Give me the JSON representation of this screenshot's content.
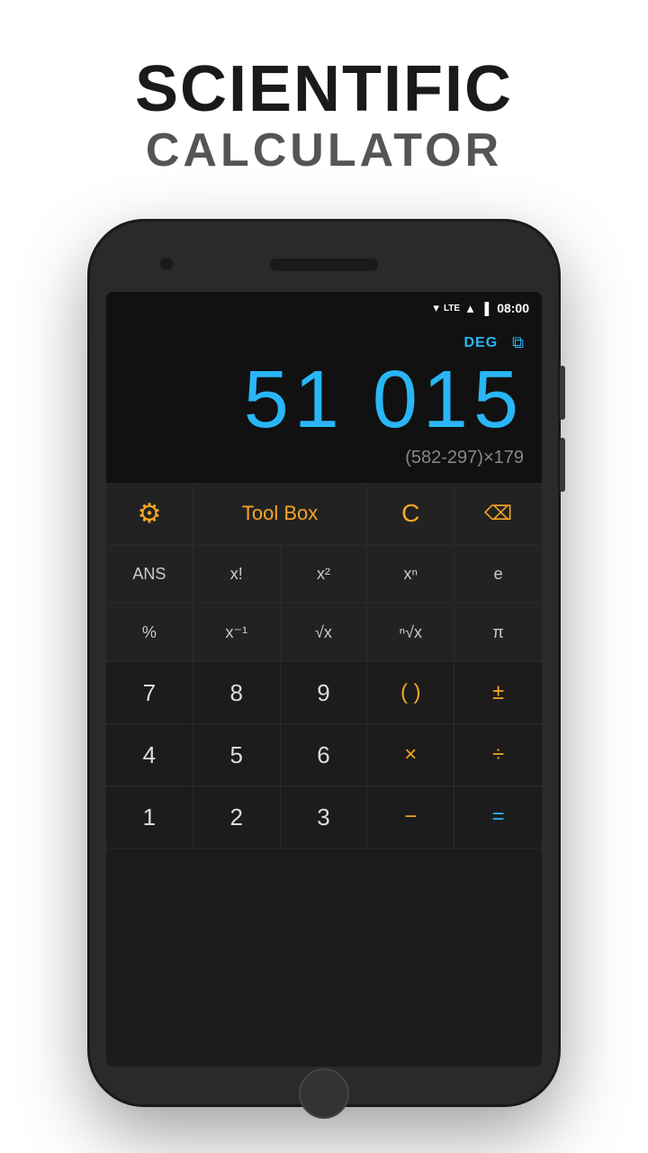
{
  "header": {
    "line1": "SCIENTIFIC",
    "line2": "CALCULATOR"
  },
  "status_bar": {
    "time": "08:00",
    "lte": "LTE"
  },
  "calculator": {
    "deg_label": "DEG",
    "result": "51 015",
    "expression": "(582-297)×179",
    "toolbar": {
      "toolbox_label": "Tool Box",
      "clear_label": "C"
    },
    "sci_row1": [
      {
        "label": "ANS",
        "id": "ans-btn"
      },
      {
        "label": "x!",
        "id": "factorial-btn"
      },
      {
        "label": "x²",
        "id": "square-btn"
      },
      {
        "label": "xⁿ",
        "id": "power-btn"
      },
      {
        "label": "e",
        "id": "euler-btn"
      }
    ],
    "sci_row2": [
      {
        "label": "%",
        "id": "percent-btn"
      },
      {
        "label": "x⁻¹",
        "id": "inverse-btn"
      },
      {
        "label": "√x",
        "id": "sqrt-btn"
      },
      {
        "label": "ⁿ√x",
        "id": "nroot-btn"
      },
      {
        "label": "π",
        "id": "pi-btn"
      }
    ],
    "num_row1": [
      {
        "label": "7",
        "type": "num"
      },
      {
        "label": "8",
        "type": "num"
      },
      {
        "label": "9",
        "type": "num"
      },
      {
        "label": "( )",
        "type": "op"
      },
      {
        "label": "±",
        "type": "op"
      }
    ],
    "num_row2": [
      {
        "label": "4",
        "type": "num"
      },
      {
        "label": "5",
        "type": "num"
      },
      {
        "label": "6",
        "type": "num"
      },
      {
        "label": "×",
        "type": "op"
      },
      {
        "label": "÷",
        "type": "op"
      }
    ],
    "num_row3": [
      {
        "label": "1",
        "type": "num"
      },
      {
        "label": "2",
        "type": "num"
      },
      {
        "label": "3",
        "type": "num"
      },
      {
        "label": "−",
        "type": "op"
      },
      {
        "label": "=",
        "type": "op-blue"
      }
    ]
  }
}
